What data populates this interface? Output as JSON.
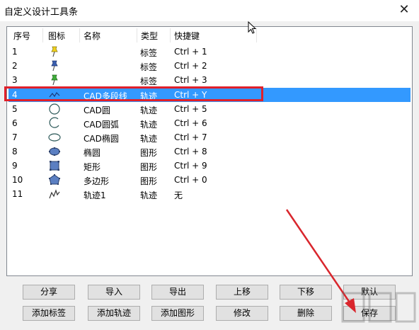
{
  "window": {
    "title": "自定义设计工具条",
    "close_glyph": "✕"
  },
  "list": {
    "columns": [
      "序号",
      "图标",
      "名称",
      "类型",
      "快捷键"
    ],
    "rows": [
      {
        "no": "1",
        "icon": "yellow-pushpin-icon",
        "name": "",
        "type": "标签",
        "shortcut": "Ctrl + 1"
      },
      {
        "no": "2",
        "icon": "blue-pushpin-icon",
        "name": "",
        "type": "标签",
        "shortcut": "Ctrl + 2"
      },
      {
        "no": "3",
        "icon": "green-pushpin-icon",
        "name": "",
        "type": "标签",
        "shortcut": "Ctrl + 3"
      },
      {
        "no": "4",
        "icon": "polyline-icon",
        "name": "CAD多段线",
        "type": "轨迹",
        "shortcut": "Ctrl + Y"
      },
      {
        "no": "5",
        "icon": "circle-icon",
        "name": "CAD圆",
        "type": "轨迹",
        "shortcut": "Ctrl + 5"
      },
      {
        "no": "6",
        "icon": "arc-icon",
        "name": "CAD圆弧",
        "type": "轨迹",
        "shortcut": "Ctrl + 6"
      },
      {
        "no": "7",
        "icon": "ellipse-icon",
        "name": "CAD椭圆",
        "type": "轨迹",
        "shortcut": "Ctrl + 7"
      },
      {
        "no": "8",
        "icon": "filled-ellipse-icon",
        "name": "椭圆",
        "type": "图形",
        "shortcut": "Ctrl + 8"
      },
      {
        "no": "9",
        "icon": "rectangle-icon",
        "name": "矩形",
        "type": "图形",
        "shortcut": "Ctrl + 9"
      },
      {
        "no": "10",
        "icon": "polygon-icon",
        "name": "多边形",
        "type": "图形",
        "shortcut": "Ctrl + 0"
      },
      {
        "no": "11",
        "icon": "track-icon",
        "name": "轨迹1",
        "type": "轨迹",
        "shortcut": "无"
      }
    ],
    "selected_row": "4"
  },
  "buttons": {
    "share": "分享",
    "import": "导入",
    "export": "导出",
    "move_up": "上移",
    "move_down": "下移",
    "default": "默认",
    "add_label": "添加标签",
    "add_track": "添加轨迹",
    "add_shape": "添加图形",
    "modify": "修改",
    "delete": "删除",
    "save": "保存"
  },
  "colors": {
    "selection": "#3399ff",
    "highlight_border": "#e0202a",
    "arrow": "#d9262d"
  }
}
